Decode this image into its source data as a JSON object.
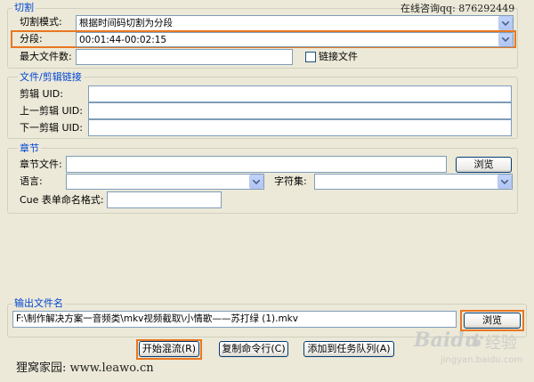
{
  "cut_section": {
    "legend": "切割",
    "contact": "在线咨询qq: 876292449",
    "mode_label": "切割模式:",
    "mode_value": "根据时间码切割为分段",
    "segment_label": "分段:",
    "segment_value": "00:01:44-00:02:15",
    "max_files_label": "最大文件数:",
    "max_files_value": "",
    "link_files_label": "链接文件"
  },
  "file_link_section": {
    "legend": "文件/剪辑链接",
    "clip_uid_label": "剪辑 UID:",
    "prev_clip_uid_label": "上一剪辑 UID:",
    "next_clip_uid_label": "下一剪辑 UID:"
  },
  "chapters_section": {
    "legend": "章节",
    "chapter_file_label": "章节文件:",
    "browse_label": "浏览",
    "language_label": "语言:",
    "charset_label": "字符集:",
    "cue_format_label": "Cue 表单命名格式:"
  },
  "output_section": {
    "legend": "输出文件名",
    "path_value": "F:\\制作解决方案一音频类\\mkv视频截取\\小情歌——苏打绿 (1).mkv",
    "browse_label": "浏览"
  },
  "actions": {
    "start_label": "开始混流(R)",
    "copy_cmd_label": "复制命令行(C)",
    "add_queue_label": "添加到任务队列(A)"
  },
  "footer": {
    "site_text": "狸窝家园: www.leawo.cn",
    "baidu_brand": "Baidu",
    "baidu_jingyan": "经验",
    "baidu_url": "jingyan.baidu.com"
  },
  "colors": {
    "highlight": "#e87722",
    "legend_text": "#0046d5",
    "window_bg": "#ece9d8"
  }
}
